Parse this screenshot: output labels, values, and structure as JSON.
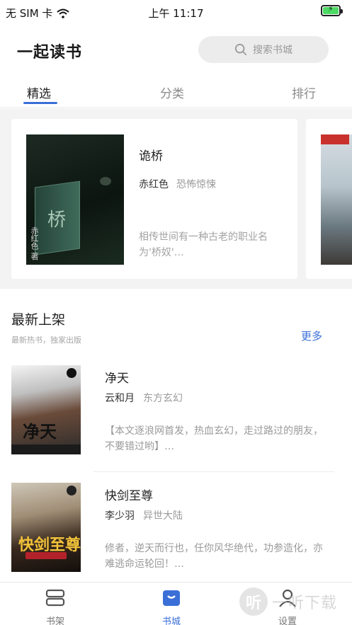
{
  "status_bar": {
    "carrier": "无 SIM 卡",
    "time": "上午 11:17"
  },
  "header": {
    "title": "一起读书",
    "search_placeholder": "搜索书城"
  },
  "tabs": [
    {
      "label": "精选",
      "active": true
    },
    {
      "label": "分类",
      "active": false
    },
    {
      "label": "排行",
      "active": false
    }
  ],
  "featured": [
    {
      "title": "诡桥",
      "author": "赤红色",
      "genre": "恐怖惊悚",
      "desc": "相传世间有一种古老的职业名为'桥奴'…",
      "cover_glyph": "桥",
      "cover_author": "赤红色 著"
    }
  ],
  "new_section": {
    "title": "最新上架",
    "subtitle": "最新热书，独家出版",
    "more": "更多",
    "books": [
      {
        "title": "净天",
        "author": "云和月",
        "genre": "东方玄幻",
        "desc": "【本文逐浪网首发，热血玄幻，走过路过的朋友，不要错过哟】…",
        "cover_text": "净天"
      },
      {
        "title": "快剑至尊",
        "author": "李少羽",
        "genre": "异世大陆",
        "desc": "修者，逆天而行也，任你风华绝代，功参造化，亦难逃命运轮回！…",
        "cover_text": "快剑至尊"
      }
    ]
  },
  "bottom_nav": [
    {
      "label": "书架",
      "icon": "bookshelf-icon",
      "active": false
    },
    {
      "label": "书城",
      "icon": "bookstore-icon",
      "active": true
    },
    {
      "label": "设置",
      "icon": "person-icon",
      "active": false
    }
  ],
  "watermark": {
    "glyph": "听",
    "text": "一听下载"
  },
  "colors": {
    "accent": "#3b6fd8",
    "battery": "#4cd964",
    "muted_text": "#9a9a9a"
  }
}
